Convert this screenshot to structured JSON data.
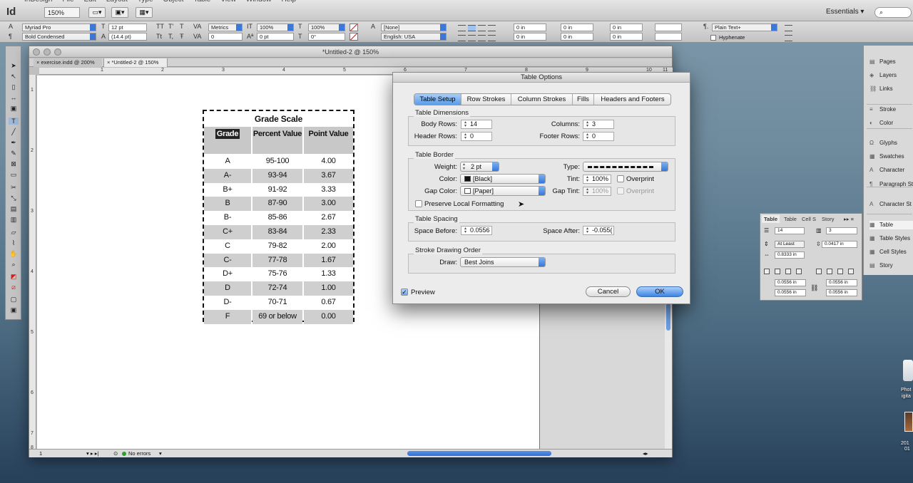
{
  "app": {
    "logo": "Id",
    "zoom": "150%",
    "workspace": "Essentials",
    "search_placeholder": ""
  },
  "control_bar": {
    "font_family": "Myriad Pro",
    "font_style": "Bold Condensed",
    "font_size": "12 pt",
    "leading": "(14.4 pt)",
    "kerning": "Metrics",
    "tracking": "0",
    "vscale": "100%",
    "hscale": "100%",
    "baseline": "0 pt",
    "skew": "0°",
    "char_style": "[None]",
    "language": "English: USA",
    "indent1": "0 in",
    "indent2": "0 in",
    "indent3": "0 in",
    "indent4": "0 in",
    "indent5": "0 in",
    "indent6": "0 in",
    "para_style": "Plain Text+",
    "hyphenate_label": "Hyphenate"
  },
  "document": {
    "window_title": "*Untitled-2 @ 150%",
    "tabs": [
      "exercise.indd @ 200%",
      "*Untitled-2 @ 150%"
    ],
    "ruler_h": [
      "1",
      "2",
      "3",
      "4",
      "5",
      "6",
      "7",
      "8",
      "9",
      "10",
      "11"
    ],
    "ruler_v": [
      "1",
      "2",
      "3",
      "4",
      "5",
      "6",
      "7",
      "8"
    ],
    "page_number": "1",
    "errors": "No errors"
  },
  "grade_table": {
    "title": "Grade Scale",
    "headers": [
      "Grade",
      "Percent Value",
      "Point Value"
    ],
    "rows": [
      [
        "A",
        "95-100",
        "4.00"
      ],
      [
        "A-",
        "93-94",
        "3.67"
      ],
      [
        "B+",
        "91-92",
        "3.33"
      ],
      [
        "B",
        "87-90",
        "3.00"
      ],
      [
        "B-",
        "85-86",
        "2.67"
      ],
      [
        "C+",
        "83-84",
        "2.33"
      ],
      [
        "C",
        "79-82",
        "2.00"
      ],
      [
        "C-",
        "77-78",
        "1.67"
      ],
      [
        "D+",
        "75-76",
        "1.33"
      ],
      [
        "D",
        "72-74",
        "1.00"
      ],
      [
        "D-",
        "70-71",
        "0.67"
      ],
      [
        "F",
        "69 or below",
        "0.00"
      ]
    ]
  },
  "dialog": {
    "title": "Table Options",
    "tabs": [
      "Table Setup",
      "Row Strokes",
      "Column Strokes",
      "Fills",
      "Headers and Footers"
    ],
    "dimensions": {
      "legend": "Table Dimensions",
      "body_rows_label": "Body Rows:",
      "body_rows": "14",
      "columns_label": "Columns:",
      "columns": "3",
      "header_rows_label": "Header Rows:",
      "header_rows": "0",
      "footer_rows_label": "Footer Rows:",
      "footer_rows": "0"
    },
    "border": {
      "legend": "Table Border",
      "weight_label": "Weight:",
      "weight": "2 pt",
      "type_label": "Type:",
      "color_label": "Color:",
      "color": "[Black]",
      "tint_label": "Tint:",
      "tint": "100%",
      "overprint_label": "Overprint",
      "gap_color_label": "Gap Color:",
      "gap_color": "[Paper]",
      "gap_tint_label": "Gap Tint:",
      "gap_tint": "100%",
      "gap_overprint_label": "Overprint",
      "preserve_label": "Preserve Local Formatting"
    },
    "spacing": {
      "legend": "Table Spacing",
      "before_label": "Space Before:",
      "before": "0.0556",
      "after_label": "Space After:",
      "after": "-0.055("
    },
    "stroke_order": {
      "legend": "Stroke Drawing Order",
      "draw_label": "Draw:",
      "draw": "Best Joins"
    },
    "preview_label": "Preview",
    "cancel_label": "Cancel",
    "ok_label": "OK"
  },
  "panels": {
    "items": [
      "Pages",
      "Layers",
      "Links",
      "Stroke",
      "Color",
      "Glyphs",
      "Swatches",
      "Character",
      "Paragraph St",
      "Character St",
      "Table",
      "Table Styles",
      "Cell Styles",
      "Story"
    ]
  },
  "table_panel": {
    "tabs": [
      "Table",
      "Table",
      "Cell S",
      "Story"
    ],
    "rows": "14",
    "cols": "3",
    "row_height_mode": "At Least",
    "row_height": "0.0417 in",
    "col_width": "0.8333 in",
    "inset_top": "0.0556 in",
    "inset_bottom": "0.0556 in",
    "inset_left": "0.0556 in",
    "inset_right": "0.0556 in"
  },
  "desktop": {
    "label1": "Phot",
    "label2": "igita",
    "label3": "201",
    "label4": "01"
  }
}
